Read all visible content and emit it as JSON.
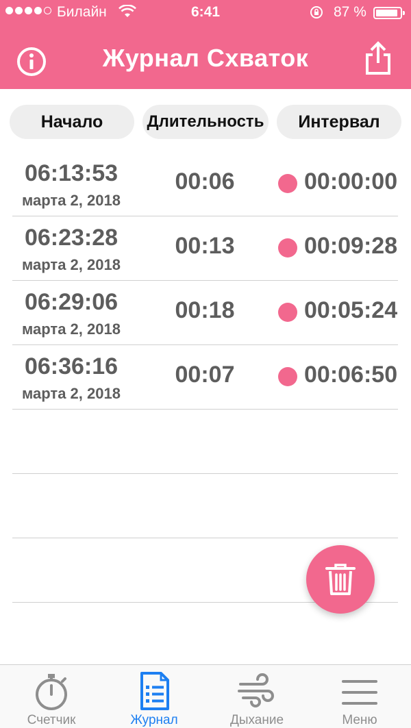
{
  "status_bar": {
    "carrier": "Билайн",
    "time": "6:41",
    "battery_percent": "87 %"
  },
  "header": {
    "title": "Журнал Схваток",
    "info_icon": "info-icon",
    "share_icon": "share-icon",
    "color": "#f2688e"
  },
  "columns": {
    "start": "Начало",
    "duration": "Длительность",
    "interval": "Интервал"
  },
  "rows": [
    {
      "time": "06:13:53",
      "date": "марта 2, 2018",
      "duration": "00:06",
      "interval": "00:00:00",
      "marker_color": "#f2688e"
    },
    {
      "time": "06:23:28",
      "date": "марта 2, 2018",
      "duration": "00:13",
      "interval": "00:09:28",
      "marker_color": "#f2688e"
    },
    {
      "time": "06:29:06",
      "date": "марта 2, 2018",
      "duration": "00:18",
      "interval": "00:05:24",
      "marker_color": "#f2688e"
    },
    {
      "time": "06:36:16",
      "date": "марта 2, 2018",
      "duration": "00:07",
      "interval": "00:06:50",
      "marker_color": "#f2688e"
    }
  ],
  "fab": {
    "icon": "trash-icon"
  },
  "tabs": [
    {
      "label": "Счетчик",
      "icon": "stopwatch-icon",
      "active": false
    },
    {
      "label": "Журнал",
      "icon": "journal-icon",
      "active": true
    },
    {
      "label": "Дыхание",
      "icon": "wind-icon",
      "active": false
    },
    {
      "label": "Меню",
      "icon": "menu-icon",
      "active": false
    }
  ],
  "colors": {
    "accent": "#f2688e",
    "active_tab": "#1d7ff1",
    "inactive_tab": "#8e8e8e"
  }
}
